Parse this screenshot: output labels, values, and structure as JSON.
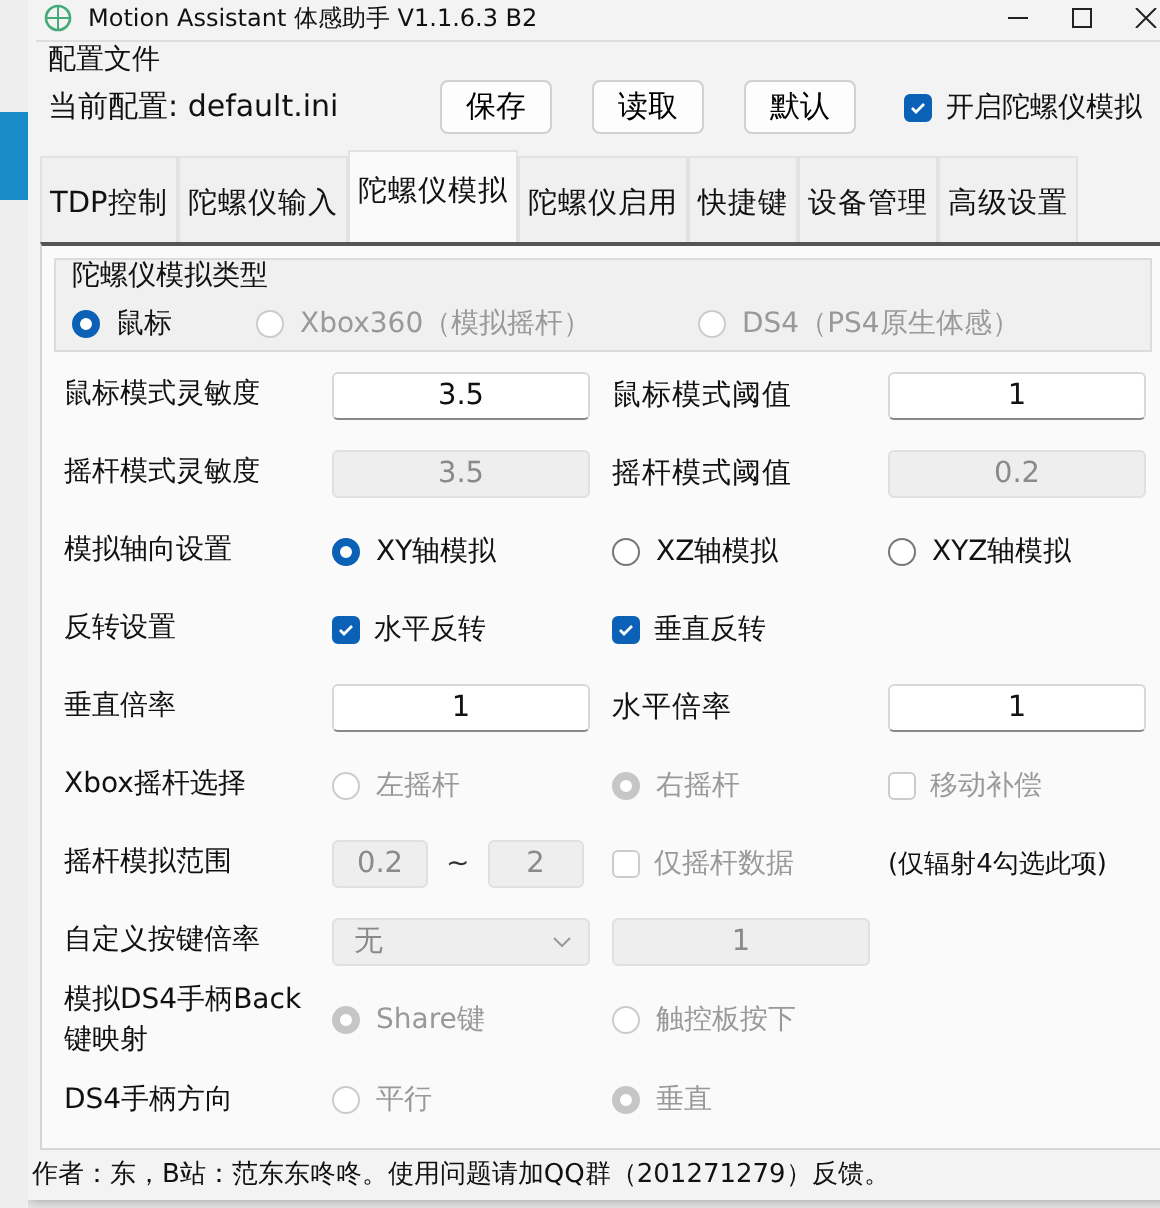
{
  "window": {
    "title": "Motion Assistant 体感助手 V1.1.6.3 B2"
  },
  "config": {
    "legend": "配置文件",
    "current": "当前配置: default.ini",
    "buttons": [
      "保存",
      "读取",
      "默认"
    ],
    "toggle": {
      "label": "开启陀螺仪模拟",
      "checked": true
    }
  },
  "tabs": [
    {
      "label": "TDP控制",
      "selected": false
    },
    {
      "label": "陀螺仪输入",
      "selected": false
    },
    {
      "label": "陀螺仪模拟",
      "selected": true
    },
    {
      "label": "陀螺仪启用",
      "selected": false
    },
    {
      "label": "快捷键",
      "selected": false
    },
    {
      "label": "设备管理",
      "selected": false
    },
    {
      "label": "高级设置",
      "selected": false
    }
  ],
  "sim_type": {
    "legend": "陀螺仪模拟类型",
    "options": [
      {
        "label": "鼠标",
        "selected": true,
        "disabled": false
      },
      {
        "label": "Xbox360（模拟摇杆）",
        "selected": false,
        "disabled": true
      },
      {
        "label": "DS4（PS4原生体感）",
        "selected": false,
        "disabled": true
      }
    ]
  },
  "rows": [
    {
      "label": "鼠标模式灵敏度",
      "items": [
        {
          "kind": "field",
          "value": "3.5",
          "disabled": false
        },
        {
          "kind": "label",
          "text": "鼠标模式阈值"
        },
        {
          "kind": "field",
          "value": "1",
          "disabled": false
        }
      ]
    },
    {
      "label": "摇杆模式灵敏度",
      "items": [
        {
          "kind": "field",
          "value": "3.5",
          "disabled": true
        },
        {
          "kind": "label",
          "text": "摇杆模式阈值"
        },
        {
          "kind": "field",
          "value": "0.2",
          "disabled": true
        }
      ]
    },
    {
      "label": "模拟轴向设置",
      "items": [
        {
          "kind": "radio",
          "label": "XY轴模拟",
          "selected": true,
          "disabled": false
        },
        {
          "kind": "radio",
          "label": "XZ轴模拟",
          "selected": false,
          "disabled": false
        },
        {
          "kind": "radio",
          "label": "XYZ轴模拟",
          "selected": false,
          "disabled": false
        }
      ]
    },
    {
      "label": "反转设置",
      "items": [
        {
          "kind": "checkbox",
          "label": "水平反转",
          "checked": true,
          "disabled": false
        },
        {
          "kind": "checkbox",
          "label": "垂直反转",
          "checked": true,
          "disabled": false
        }
      ]
    },
    {
      "label": "垂直倍率",
      "items": [
        {
          "kind": "field",
          "value": "1",
          "disabled": false
        },
        {
          "kind": "label",
          "text": "水平倍率"
        },
        {
          "kind": "field",
          "value": "1",
          "disabled": false
        }
      ]
    },
    {
      "label": "Xbox摇杆选择",
      "items": [
        {
          "kind": "radio",
          "label": "左摇杆",
          "selected": false,
          "disabled": true
        },
        {
          "kind": "radio",
          "label": "右摇杆",
          "selected": true,
          "disabled": true
        },
        {
          "kind": "checkbox",
          "label": "移动补偿",
          "checked": false,
          "disabled": true
        }
      ]
    },
    {
      "label": "摇杆模拟范围",
      "items": [
        {
          "kind": "range",
          "from": "0.2",
          "sep": "~",
          "to": "2",
          "disabled": true
        },
        {
          "kind": "checkbox",
          "label": "仅摇杆数据",
          "checked": false,
          "disabled": true
        },
        {
          "kind": "note",
          "text": "(仅辐射4勾选此项)"
        }
      ]
    },
    {
      "label": "自定义按键倍率",
      "items": [
        {
          "kind": "select",
          "value": "无",
          "disabled": true
        },
        {
          "kind": "field",
          "value": "1",
          "disabled": true
        }
      ]
    },
    {
      "label": "模拟DS4手柄Back键映射",
      "items": [
        {
          "kind": "radio",
          "label": "Share键",
          "selected": true,
          "disabled": true
        },
        {
          "kind": "radio",
          "label": "触控板按下",
          "selected": false,
          "disabled": true
        }
      ]
    },
    {
      "label": "DS4手柄方向",
      "items": [
        {
          "kind": "radio",
          "label": "平行",
          "selected": false,
          "disabled": true
        },
        {
          "kind": "radio",
          "label": "垂直",
          "selected": true,
          "disabled": true
        }
      ]
    }
  ],
  "status_bar": "作者：东，B站：范东东咚咚。使用问题请加QQ群（201271279）反馈。"
}
